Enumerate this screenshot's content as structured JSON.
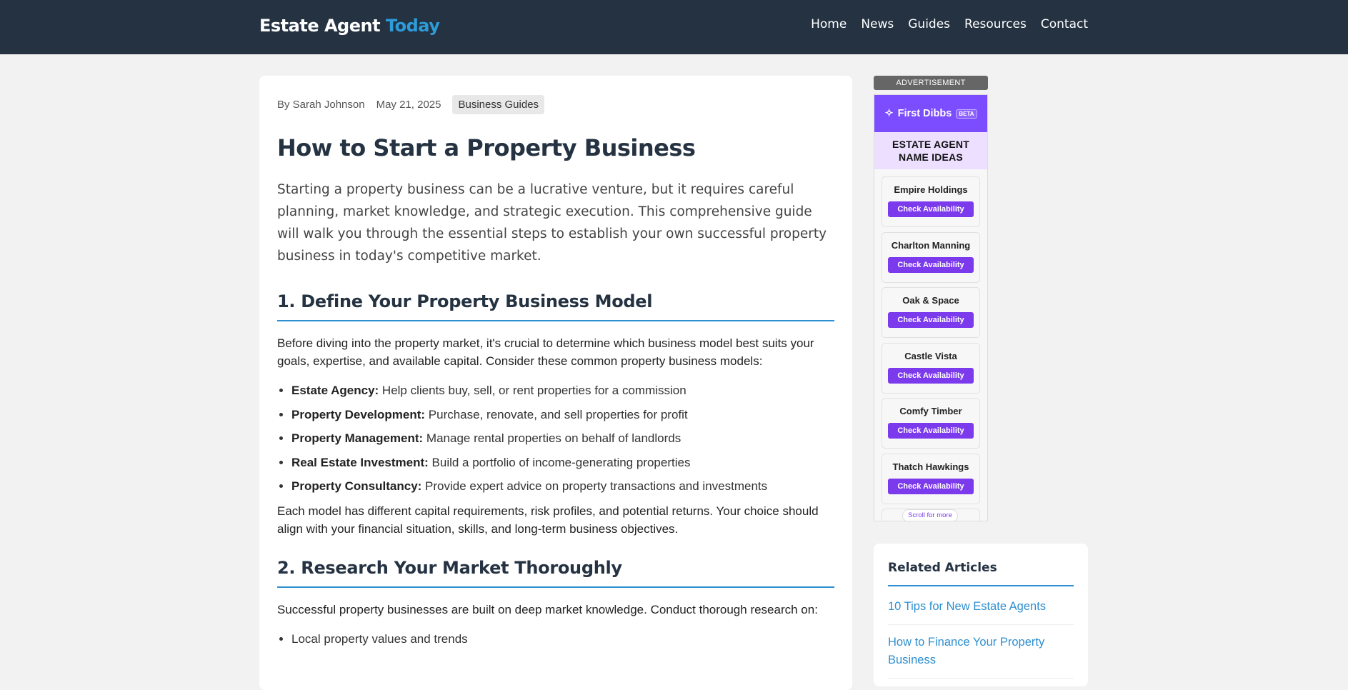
{
  "header": {
    "logo_main": "Estate Agent",
    "logo_accent": "Today",
    "nav": [
      "Home",
      "News",
      "Guides",
      "Resources",
      "Contact"
    ]
  },
  "article": {
    "author": "By Sarah Johnson",
    "date": "May 21, 2025",
    "category": "Business Guides",
    "title": "How to Start a Property Business",
    "lede": "Starting a property business can be a lucrative venture, but it requires careful planning, market knowledge, and strategic execution. This comprehensive guide will walk you through the essential steps to establish your own successful property business in today's competitive market.",
    "section1": {
      "heading": "1. Define Your Property Business Model",
      "intro": "Before diving into the property market, it's crucial to determine which business model best suits your goals, expertise, and available capital. Consider these common property business models:",
      "items": [
        {
          "term": "Estate Agency:",
          "desc": " Help clients buy, sell, or rent properties for a commission"
        },
        {
          "term": "Property Development:",
          "desc": " Purchase, renovate, and sell properties for profit"
        },
        {
          "term": "Property Management:",
          "desc": " Manage rental properties on behalf of landlords"
        },
        {
          "term": "Real Estate Investment:",
          "desc": " Build a portfolio of income-generating properties"
        },
        {
          "term": "Property Consultancy:",
          "desc": " Provide expert advice on property transactions and investments"
        }
      ],
      "outro": "Each model has different capital requirements, risk profiles, and potential returns. Your choice should align with your financial situation, skills, and long-term business objectives."
    },
    "section2": {
      "heading": "2. Research Your Market Thoroughly",
      "intro": "Successful property businesses are built on deep market knowledge. Conduct thorough research on:",
      "items": [
        "Local property values and trends"
      ]
    }
  },
  "ad": {
    "tag": "ADVERTISEMENT",
    "brand": "First Dibbs",
    "brand_icon": "sparkle-icon",
    "beta": "BETA",
    "heading_line1": "ESTATE AGENT",
    "heading_line2": "NAME IDEAS",
    "button_label": "Check Availability",
    "names": [
      "Empire Holdings",
      "Charlton Manning",
      "Oak & Space",
      "Castle Vista",
      "Comfy Timber",
      "Thatch Hawkings"
    ],
    "scroll_hint": "Scroll for more"
  },
  "related": {
    "title": "Related Articles",
    "links": [
      "10 Tips for New Estate Agents",
      "How to Finance Your Property Business"
    ]
  },
  "colors": {
    "header_bg": "#243242",
    "accent_blue": "#2d9cdb",
    "ad_purple": "#7c3aed"
  }
}
